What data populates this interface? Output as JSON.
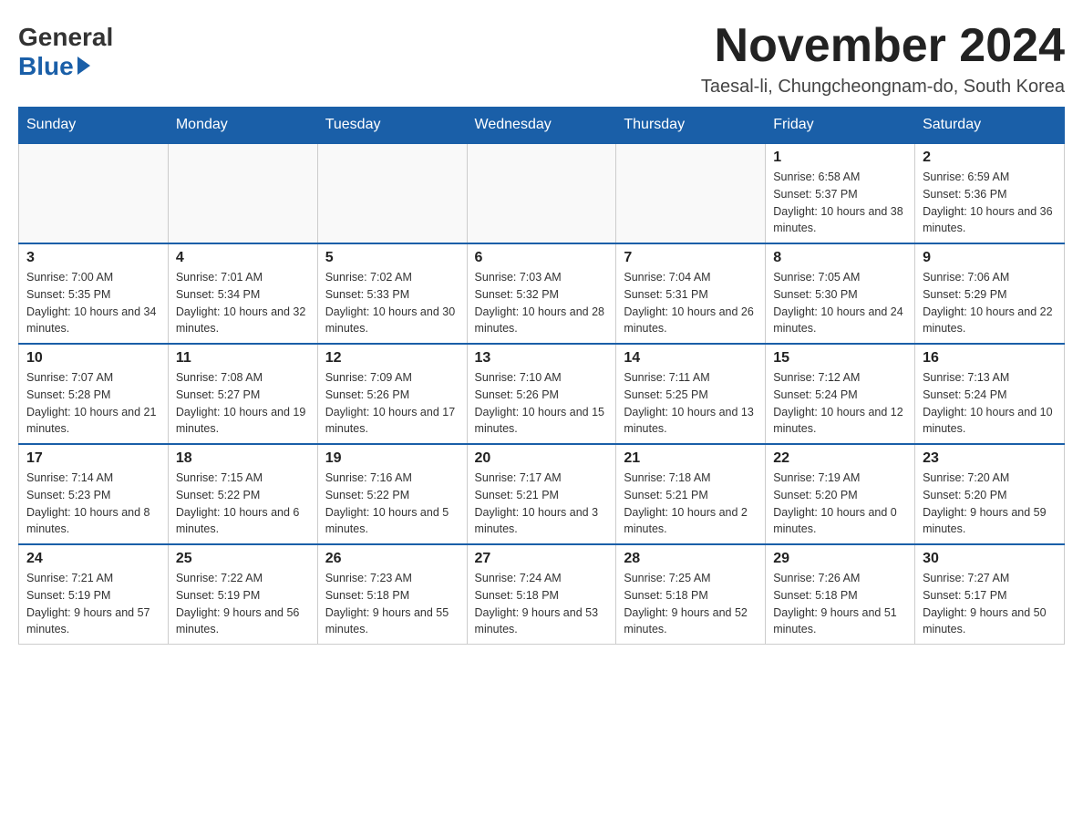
{
  "header": {
    "logo_general": "General",
    "logo_blue": "Blue",
    "month_title": "November 2024",
    "location": "Taesal-li, Chungcheongnam-do, South Korea"
  },
  "days_of_week": [
    "Sunday",
    "Monday",
    "Tuesday",
    "Wednesday",
    "Thursday",
    "Friday",
    "Saturday"
  ],
  "weeks": [
    [
      {
        "day": "",
        "sunrise": "",
        "sunset": "",
        "daylight": ""
      },
      {
        "day": "",
        "sunrise": "",
        "sunset": "",
        "daylight": ""
      },
      {
        "day": "",
        "sunrise": "",
        "sunset": "",
        "daylight": ""
      },
      {
        "day": "",
        "sunrise": "",
        "sunset": "",
        "daylight": ""
      },
      {
        "day": "",
        "sunrise": "",
        "sunset": "",
        "daylight": ""
      },
      {
        "day": "1",
        "sunrise": "Sunrise: 6:58 AM",
        "sunset": "Sunset: 5:37 PM",
        "daylight": "Daylight: 10 hours and 38 minutes."
      },
      {
        "day": "2",
        "sunrise": "Sunrise: 6:59 AM",
        "sunset": "Sunset: 5:36 PM",
        "daylight": "Daylight: 10 hours and 36 minutes."
      }
    ],
    [
      {
        "day": "3",
        "sunrise": "Sunrise: 7:00 AM",
        "sunset": "Sunset: 5:35 PM",
        "daylight": "Daylight: 10 hours and 34 minutes."
      },
      {
        "day": "4",
        "sunrise": "Sunrise: 7:01 AM",
        "sunset": "Sunset: 5:34 PM",
        "daylight": "Daylight: 10 hours and 32 minutes."
      },
      {
        "day": "5",
        "sunrise": "Sunrise: 7:02 AM",
        "sunset": "Sunset: 5:33 PM",
        "daylight": "Daylight: 10 hours and 30 minutes."
      },
      {
        "day": "6",
        "sunrise": "Sunrise: 7:03 AM",
        "sunset": "Sunset: 5:32 PM",
        "daylight": "Daylight: 10 hours and 28 minutes."
      },
      {
        "day": "7",
        "sunrise": "Sunrise: 7:04 AM",
        "sunset": "Sunset: 5:31 PM",
        "daylight": "Daylight: 10 hours and 26 minutes."
      },
      {
        "day": "8",
        "sunrise": "Sunrise: 7:05 AM",
        "sunset": "Sunset: 5:30 PM",
        "daylight": "Daylight: 10 hours and 24 minutes."
      },
      {
        "day": "9",
        "sunrise": "Sunrise: 7:06 AM",
        "sunset": "Sunset: 5:29 PM",
        "daylight": "Daylight: 10 hours and 22 minutes."
      }
    ],
    [
      {
        "day": "10",
        "sunrise": "Sunrise: 7:07 AM",
        "sunset": "Sunset: 5:28 PM",
        "daylight": "Daylight: 10 hours and 21 minutes."
      },
      {
        "day": "11",
        "sunrise": "Sunrise: 7:08 AM",
        "sunset": "Sunset: 5:27 PM",
        "daylight": "Daylight: 10 hours and 19 minutes."
      },
      {
        "day": "12",
        "sunrise": "Sunrise: 7:09 AM",
        "sunset": "Sunset: 5:26 PM",
        "daylight": "Daylight: 10 hours and 17 minutes."
      },
      {
        "day": "13",
        "sunrise": "Sunrise: 7:10 AM",
        "sunset": "Sunset: 5:26 PM",
        "daylight": "Daylight: 10 hours and 15 minutes."
      },
      {
        "day": "14",
        "sunrise": "Sunrise: 7:11 AM",
        "sunset": "Sunset: 5:25 PM",
        "daylight": "Daylight: 10 hours and 13 minutes."
      },
      {
        "day": "15",
        "sunrise": "Sunrise: 7:12 AM",
        "sunset": "Sunset: 5:24 PM",
        "daylight": "Daylight: 10 hours and 12 minutes."
      },
      {
        "day": "16",
        "sunrise": "Sunrise: 7:13 AM",
        "sunset": "Sunset: 5:24 PM",
        "daylight": "Daylight: 10 hours and 10 minutes."
      }
    ],
    [
      {
        "day": "17",
        "sunrise": "Sunrise: 7:14 AM",
        "sunset": "Sunset: 5:23 PM",
        "daylight": "Daylight: 10 hours and 8 minutes."
      },
      {
        "day": "18",
        "sunrise": "Sunrise: 7:15 AM",
        "sunset": "Sunset: 5:22 PM",
        "daylight": "Daylight: 10 hours and 6 minutes."
      },
      {
        "day": "19",
        "sunrise": "Sunrise: 7:16 AM",
        "sunset": "Sunset: 5:22 PM",
        "daylight": "Daylight: 10 hours and 5 minutes."
      },
      {
        "day": "20",
        "sunrise": "Sunrise: 7:17 AM",
        "sunset": "Sunset: 5:21 PM",
        "daylight": "Daylight: 10 hours and 3 minutes."
      },
      {
        "day": "21",
        "sunrise": "Sunrise: 7:18 AM",
        "sunset": "Sunset: 5:21 PM",
        "daylight": "Daylight: 10 hours and 2 minutes."
      },
      {
        "day": "22",
        "sunrise": "Sunrise: 7:19 AM",
        "sunset": "Sunset: 5:20 PM",
        "daylight": "Daylight: 10 hours and 0 minutes."
      },
      {
        "day": "23",
        "sunrise": "Sunrise: 7:20 AM",
        "sunset": "Sunset: 5:20 PM",
        "daylight": "Daylight: 9 hours and 59 minutes."
      }
    ],
    [
      {
        "day": "24",
        "sunrise": "Sunrise: 7:21 AM",
        "sunset": "Sunset: 5:19 PM",
        "daylight": "Daylight: 9 hours and 57 minutes."
      },
      {
        "day": "25",
        "sunrise": "Sunrise: 7:22 AM",
        "sunset": "Sunset: 5:19 PM",
        "daylight": "Daylight: 9 hours and 56 minutes."
      },
      {
        "day": "26",
        "sunrise": "Sunrise: 7:23 AM",
        "sunset": "Sunset: 5:18 PM",
        "daylight": "Daylight: 9 hours and 55 minutes."
      },
      {
        "day": "27",
        "sunrise": "Sunrise: 7:24 AM",
        "sunset": "Sunset: 5:18 PM",
        "daylight": "Daylight: 9 hours and 53 minutes."
      },
      {
        "day": "28",
        "sunrise": "Sunrise: 7:25 AM",
        "sunset": "Sunset: 5:18 PM",
        "daylight": "Daylight: 9 hours and 52 minutes."
      },
      {
        "day": "29",
        "sunrise": "Sunrise: 7:26 AM",
        "sunset": "Sunset: 5:18 PM",
        "daylight": "Daylight: 9 hours and 51 minutes."
      },
      {
        "day": "30",
        "sunrise": "Sunrise: 7:27 AM",
        "sunset": "Sunset: 5:17 PM",
        "daylight": "Daylight: 9 hours and 50 minutes."
      }
    ]
  ]
}
